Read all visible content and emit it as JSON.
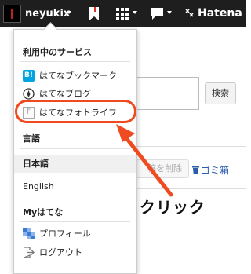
{
  "header": {
    "username": "neyukix",
    "logo_text": "Hatena",
    "icons": [
      "avatar",
      "bookmark-icon",
      "grid-icon",
      "chat-icon",
      "hatena-logo-icon"
    ]
  },
  "background_page": {
    "search_button_label": "検索",
    "delete_button_label": "稿を削除",
    "trash_link_label": "ゴミ箱",
    "annotation_text": "クリック"
  },
  "menu": {
    "services_heading": "利用中のサービス",
    "services": [
      {
        "label": "はてなブックマーク",
        "icon": "hatena-bookmark-icon",
        "icon_text": "B!"
      },
      {
        "label": "はてなブログ",
        "icon": "hatena-blog-icon"
      },
      {
        "label": "はてなフォトライフ",
        "icon": "fotolife-icon",
        "icon_text": "F",
        "highlighted": true
      }
    ],
    "language_heading": "言語",
    "languages": [
      {
        "label": "日本語",
        "selected": true
      },
      {
        "label": "English",
        "selected": false
      }
    ],
    "my_heading": "Myはてな",
    "my_items": [
      {
        "label": "プロフィール",
        "icon": "profile-icon"
      },
      {
        "label": "ログアウト",
        "icon": "logout-icon"
      }
    ]
  },
  "colors": {
    "header_bg": "#1e1e1e",
    "highlight": "#f04a20",
    "bookmark_blue": "#00a4de",
    "link_blue": "#2a5db0"
  }
}
